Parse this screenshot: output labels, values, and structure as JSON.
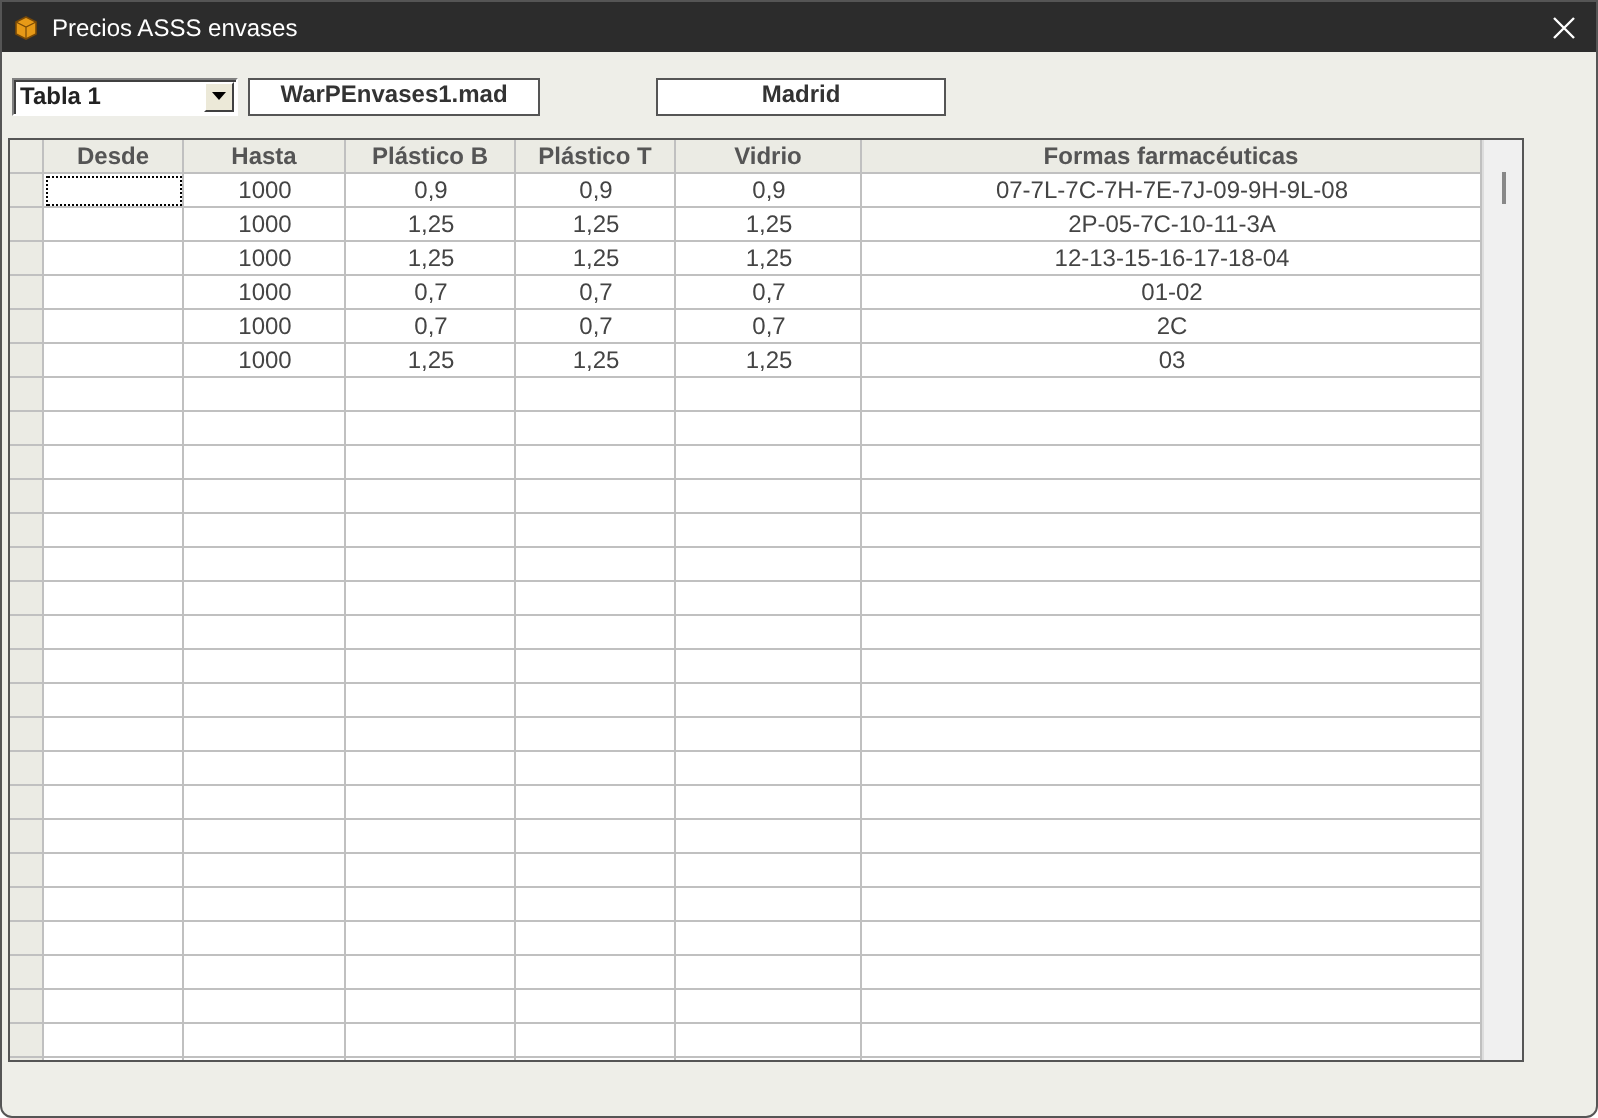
{
  "window": {
    "title": "Precios ASSS envases"
  },
  "toolbar": {
    "table_select": {
      "value": "Tabla 1"
    },
    "file_field": {
      "value": "WarPEnvases1.mad"
    },
    "region_field": {
      "value": "Madrid"
    }
  },
  "table": {
    "columns": [
      "Desde",
      "Hasta",
      "Plástico B",
      "Plástico T",
      "Vidrio",
      "Formas farmacéuticas"
    ],
    "rows": [
      {
        "focused": true,
        "cells": [
          "",
          "1000",
          "0,9",
          "0,9",
          "0,9",
          "07-7L-7C-7H-7E-7J-09-9H-9L-08"
        ]
      },
      {
        "focused": false,
        "cells": [
          "",
          "1000",
          "1,25",
          "1,25",
          "1,25",
          "2P-05-7C-10-11-3A"
        ]
      },
      {
        "focused": false,
        "cells": [
          "",
          "1000",
          "1,25",
          "1,25",
          "1,25",
          "12-13-15-16-17-18-04"
        ]
      },
      {
        "focused": false,
        "cells": [
          "",
          "1000",
          "0,7",
          "0,7",
          "0,7",
          "01-02"
        ]
      },
      {
        "focused": false,
        "cells": [
          "",
          "1000",
          "0,7",
          "0,7",
          "0,7",
          "2C"
        ]
      },
      {
        "focused": false,
        "cells": [
          "",
          "1000",
          "1,25",
          "1,25",
          "1,25",
          "03"
        ]
      }
    ]
  }
}
